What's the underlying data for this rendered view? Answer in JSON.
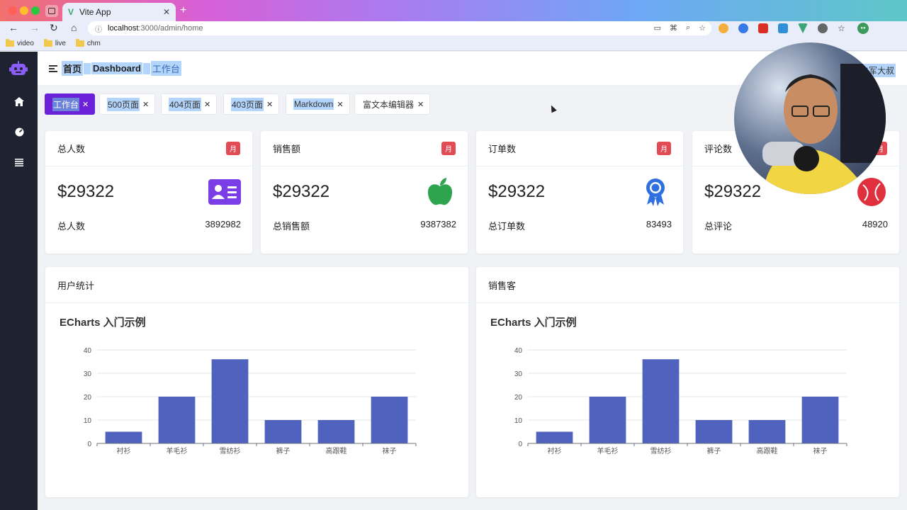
{
  "browser": {
    "tab_title": "Vite App",
    "url_host": "localhost",
    "url_path": ":3000/admin/home",
    "bookmarks": [
      "video",
      "live",
      "chm"
    ]
  },
  "header": {
    "breadcrumb": [
      "首页",
      "Dashboard",
      "工作台"
    ],
    "user_name": "白军大叔"
  },
  "tags": [
    {
      "label": "工作台",
      "active": true
    },
    {
      "label": "500页面",
      "active": false
    },
    {
      "label": "404页面",
      "active": false
    },
    {
      "label": "403页面",
      "active": false
    },
    {
      "label": "Markdown",
      "active": false
    },
    {
      "label": "富文本编辑器",
      "active": false
    }
  ],
  "stats": [
    {
      "title": "总人数",
      "badge": "月",
      "value": "$29322",
      "foot_label": "总人数",
      "foot_value": "3892982",
      "icon": "id-card-icon",
      "color": "#7b3ee6"
    },
    {
      "title": "销售额",
      "badge": "月",
      "value": "$29322",
      "foot_label": "总销售额",
      "foot_value": "9387382",
      "icon": "apple-icon",
      "color": "#2ea44f"
    },
    {
      "title": "订单数",
      "badge": "月",
      "value": "$29322",
      "foot_label": "总订单数",
      "foot_value": "83493",
      "icon": "award-icon",
      "color": "#2f6fe0"
    },
    {
      "title": "评论数",
      "badge": "月",
      "value": "$29322",
      "foot_label": "总评论",
      "foot_value": "48920",
      "icon": "ball-icon",
      "color": "#e0303d"
    }
  ],
  "charts": [
    {
      "card_title": "用户统计"
    },
    {
      "card_title": "销售客"
    }
  ],
  "chart_data": [
    {
      "type": "bar",
      "title": "ECharts 入门示例",
      "categories": [
        "衬衫",
        "羊毛衫",
        "雪纺衫",
        "裤子",
        "高跟鞋",
        "袜子"
      ],
      "values": [
        5,
        20,
        36,
        10,
        10,
        20
      ],
      "ylim": [
        0,
        40
      ],
      "yticks": [
        0,
        10,
        20,
        30,
        40
      ],
      "grid": true,
      "color": "#4f62bd"
    },
    {
      "type": "bar",
      "title": "ECharts 入门示例",
      "categories": [
        "衬衫",
        "羊毛衫",
        "雪纺衫",
        "裤子",
        "高跟鞋",
        "袜子"
      ],
      "values": [
        5,
        20,
        36,
        10,
        10,
        20
      ],
      "ylim": [
        0,
        40
      ],
      "yticks": [
        0,
        10,
        20,
        30,
        40
      ],
      "grid": true,
      "color": "#4f62bd"
    }
  ]
}
